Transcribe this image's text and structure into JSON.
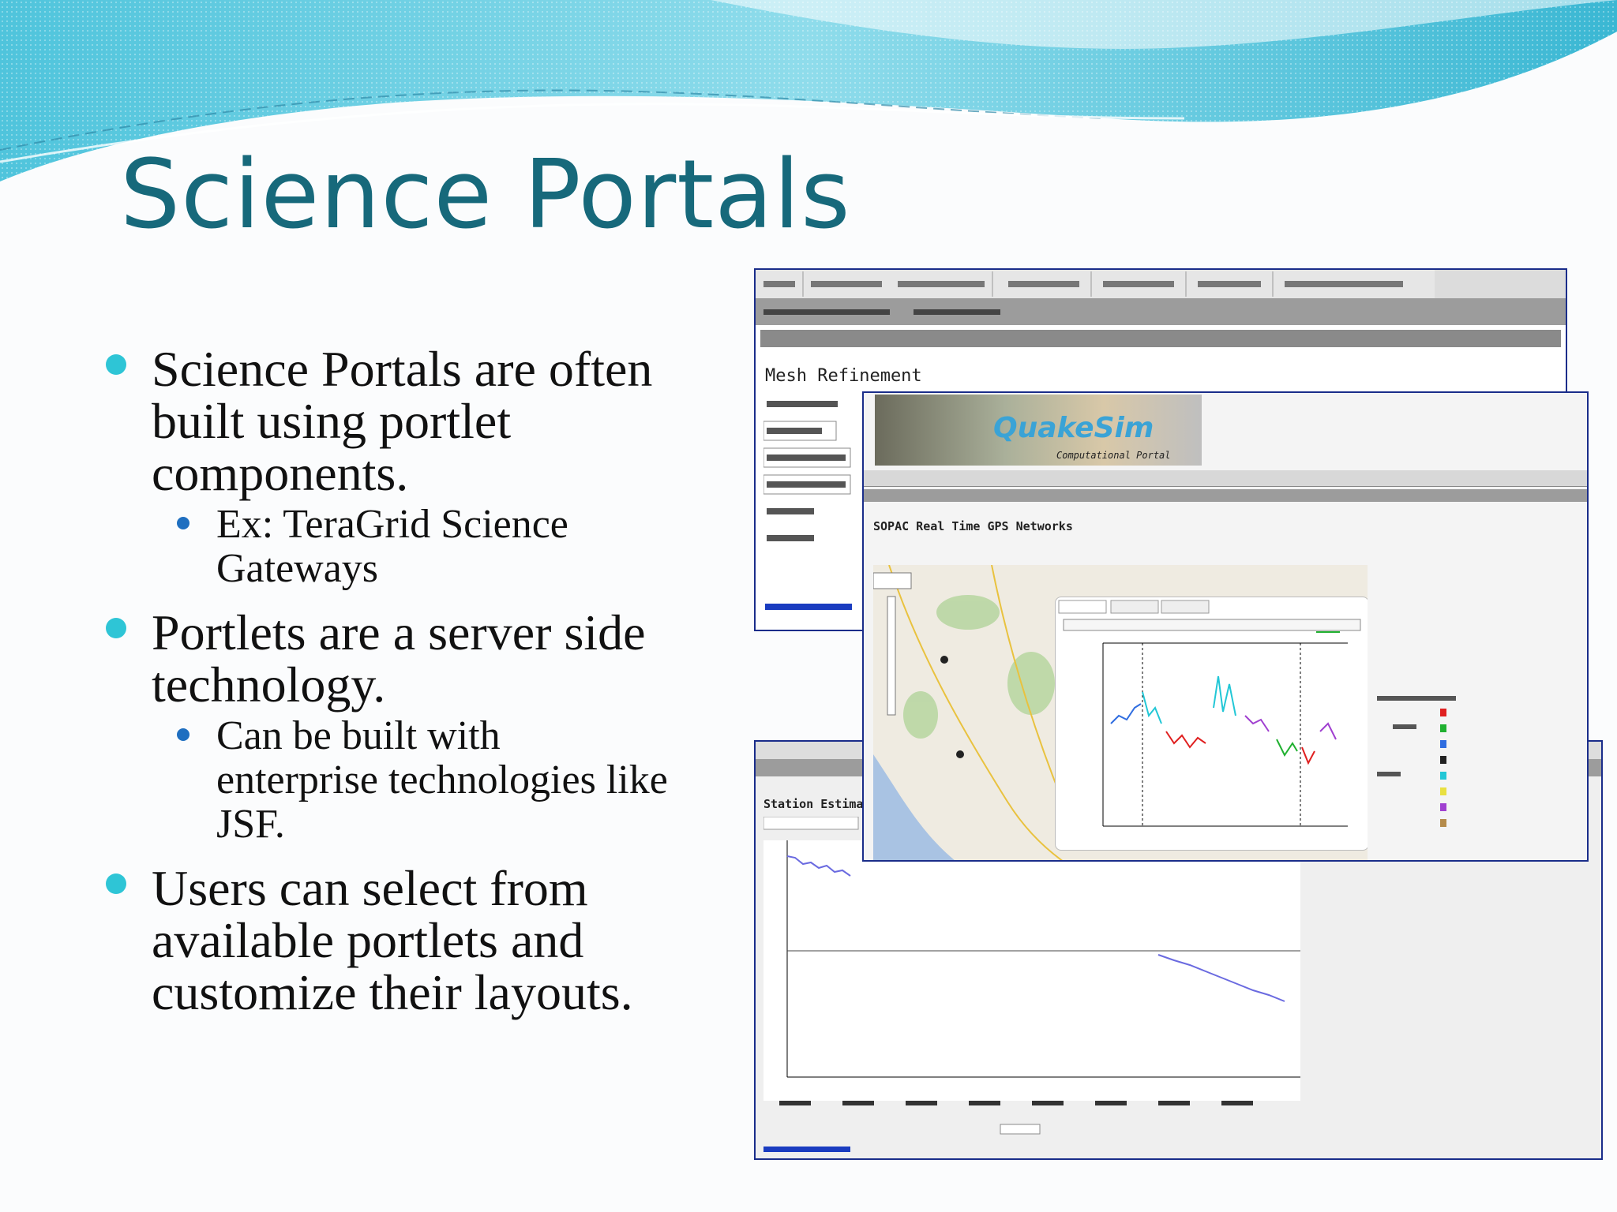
{
  "slide": {
    "title": "Science Portals",
    "bullets": [
      {
        "text": "Science Portals are often built using portlet components.",
        "lines": [
          "Science Portals are often",
          "built using portlet",
          "components."
        ],
        "sub": [
          {
            "lines": [
              "Ex: TeraGrid Science",
              "Gateways"
            ]
          }
        ]
      },
      {
        "lines": [
          "Portlets are a server side",
          "technology."
        ],
        "sub": [
          {
            "lines": [
              "Can be built with",
              "enterprise technologies like",
              "JSF."
            ]
          }
        ]
      },
      {
        "lines": [
          "Users can select from",
          "available portlets and",
          "customize their layouts."
        ],
        "sub": []
      }
    ]
  },
  "colors": {
    "title": "#17697b",
    "bullet": "#2ec5d6",
    "sub_bullet": "#1f6fc0",
    "window_border": "#1a2d8a"
  },
  "screenshots": {
    "back_window_heading": "Mesh Refinement",
    "logo_text": "QuakeSim",
    "logo_subtitle": "Computational Portal",
    "map_panel_heading": "SOPAC Real Time GPS Networks",
    "bottom_window_heading": "Station Estima"
  }
}
